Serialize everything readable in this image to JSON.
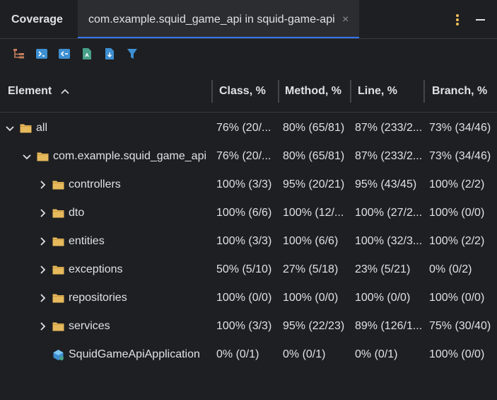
{
  "header": {
    "panel_title": "Coverage",
    "tab_label": "com.example.squid_game_api in squid-game-api",
    "tab_close": "×"
  },
  "toolbar": {
    "buttons": [
      "flatten-packages-icon",
      "navigate-to-source-icon",
      "import-coverage-icon",
      "generate-report-icon",
      "export-icon",
      "filter-icon"
    ]
  },
  "table": {
    "columns": [
      "Element",
      "Class, %",
      "Method, %",
      "Line, %",
      "Branch, %"
    ],
    "sorted_column": "Element",
    "rows": [
      {
        "name": "all",
        "type": "folder",
        "expanded": true,
        "cls": "76% (20/...",
        "method": "80% (65/81)",
        "line": "87% (233/2...",
        "branch": "73% (34/46)"
      },
      {
        "name": "com.example.squid_game_api",
        "type": "folder",
        "expanded": true,
        "cls": "76% (20/...",
        "method": "80% (65/81)",
        "line": "87% (233/2...",
        "branch": "73% (34/46)"
      },
      {
        "name": "controllers",
        "type": "folder",
        "expanded": false,
        "cls": "100% (3/3)",
        "method": "95% (20/21)",
        "line": "95% (43/45)",
        "branch": "100% (2/2)"
      },
      {
        "name": "dto",
        "type": "folder",
        "expanded": false,
        "cls": "100% (6/6)",
        "method": "100% (12/...",
        "line": "100% (27/2...",
        "branch": "100% (0/0)"
      },
      {
        "name": "entities",
        "type": "folder",
        "expanded": false,
        "cls": "100% (3/3)",
        "method": "100% (6/6)",
        "line": "100% (32/3...",
        "branch": "100% (2/2)"
      },
      {
        "name": "exceptions",
        "type": "folder",
        "expanded": false,
        "cls": "50% (5/10)",
        "method": "27% (5/18)",
        "line": "23% (5/21)",
        "branch": "0% (0/2)"
      },
      {
        "name": "repositories",
        "type": "folder",
        "expanded": false,
        "cls": "100% (0/0)",
        "method": "100% (0/0)",
        "line": "100% (0/0)",
        "branch": "100% (0/0)"
      },
      {
        "name": "services",
        "type": "folder",
        "expanded": false,
        "cls": "100% (3/3)",
        "method": "95% (22/23)",
        "line": "89% (126/1...",
        "branch": "75% (30/40)"
      },
      {
        "name": "SquidGameApiApplication",
        "type": "class",
        "expanded": null,
        "cls": "0% (0/1)",
        "method": "0% (0/1)",
        "line": "0% (0/1)",
        "branch": "100% (0/0)"
      }
    ]
  },
  "colors": {
    "background": "#1e1f22",
    "tab_background": "#2b2d30",
    "accent": "#3574f0",
    "folder": "#e6b95c",
    "kebab": "#f0c05a",
    "text": "#dfe1e5"
  }
}
